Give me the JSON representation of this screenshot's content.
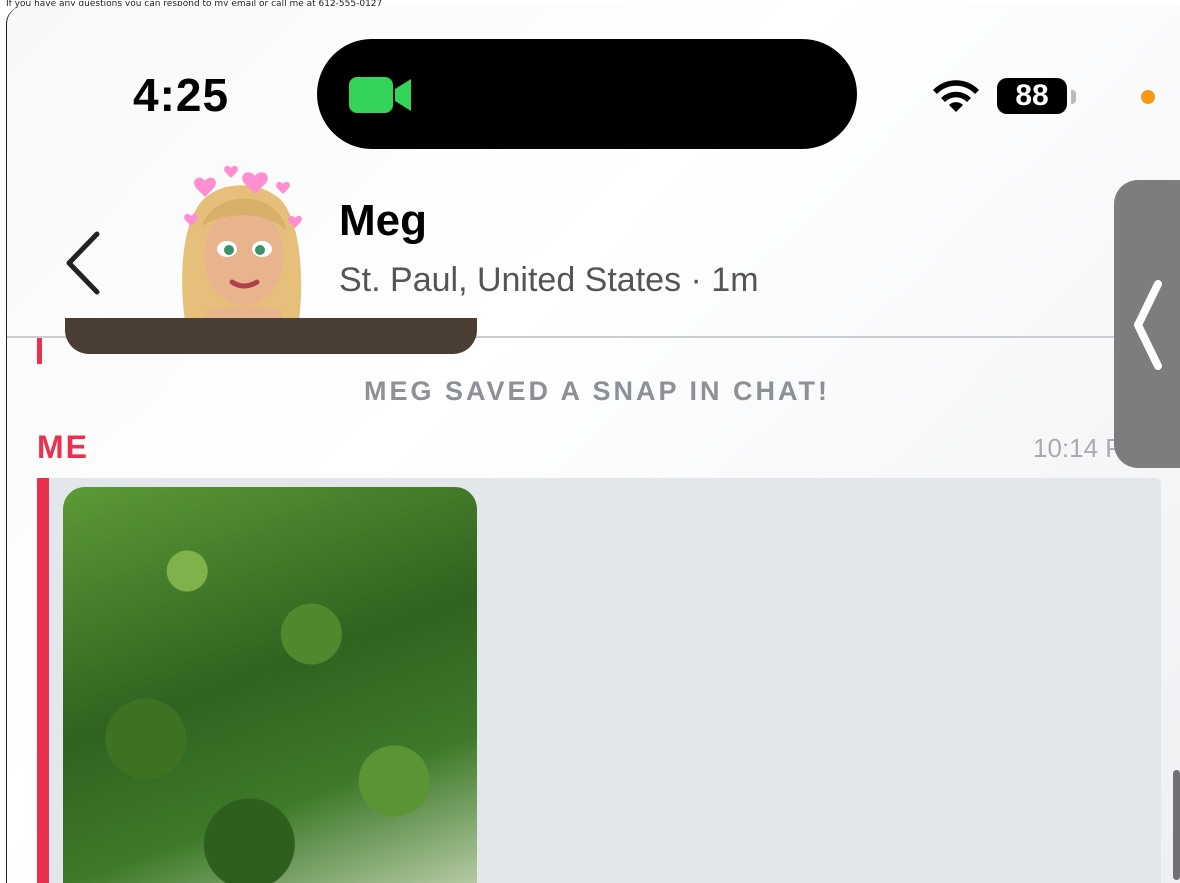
{
  "top_note": "If you have any questions you can respond to my email or call me at 612-555-0127",
  "status_bar": {
    "time": "4:25",
    "battery": "88",
    "icons": [
      "facetime-camera-icon",
      "wifi-icon",
      "battery-icon",
      "recording-indicator"
    ],
    "camera_color": "#34d35a",
    "record_dot_color": "#f59a12"
  },
  "header": {
    "contact_name": "Meg",
    "location": "St. Paul, United States · 1m",
    "back_icon": "chevron-left-icon"
  },
  "chat": {
    "saved_notice": "MEG SAVED A SNAP IN CHAT!",
    "message": {
      "sender": "ME",
      "time": "10:14 P",
      "accent_color": "#e8314e"
    }
  },
  "side_handle_icon": "chevron-left-icon"
}
